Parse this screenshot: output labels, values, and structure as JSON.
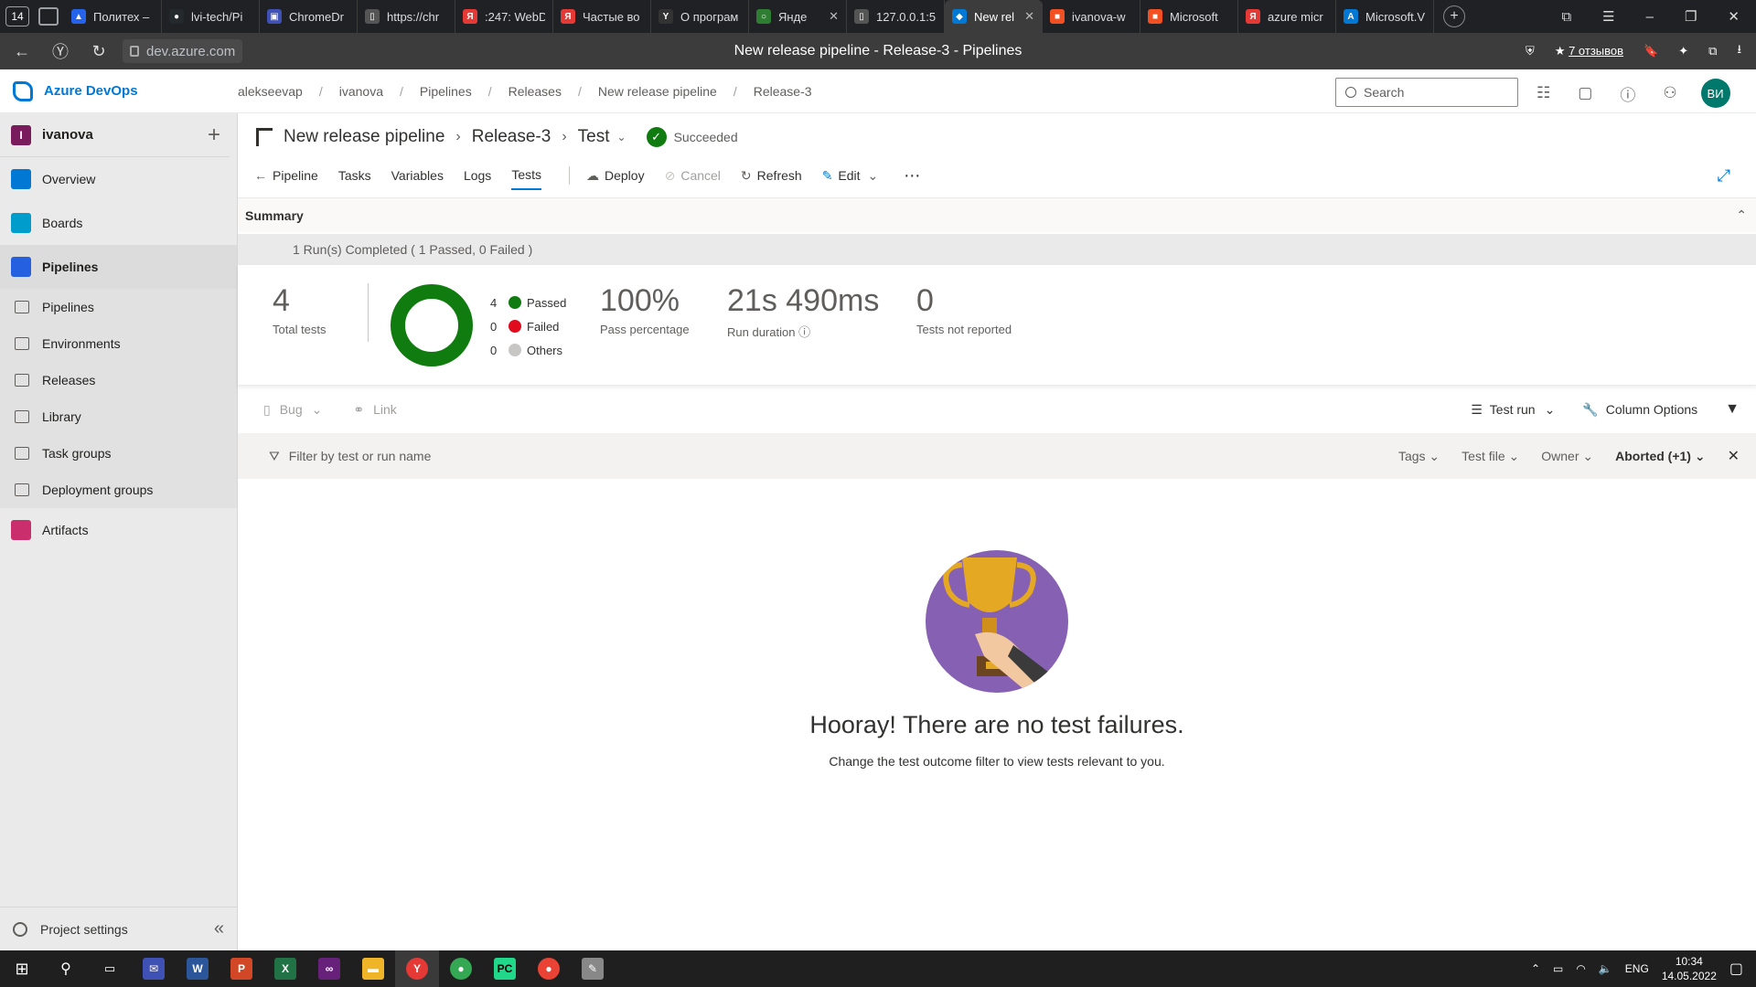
{
  "browser": {
    "tab_count": "14",
    "tabs": [
      {
        "label": "Политех –",
        "color": "#2563eb",
        "glyph": "▲"
      },
      {
        "label": "lvi-tech/Pi",
        "color": "#24292e",
        "glyph": "●"
      },
      {
        "label": "ChromeDr",
        "color": "#3f51b5",
        "glyph": "▣"
      },
      {
        "label": "https://chr",
        "color": "#555555",
        "glyph": "▯"
      },
      {
        "label": ":247: WebD",
        "color": "#e53935",
        "glyph": "Я"
      },
      {
        "label": "Частые во",
        "color": "#e53935",
        "glyph": "Я"
      },
      {
        "label": "О програм",
        "color": "#333333",
        "glyph": "Y"
      },
      {
        "label": "Янде",
        "color": "#2e7d32",
        "glyph": "○"
      },
      {
        "label": "127.0.0.1:5",
        "color": "#555555",
        "glyph": "▯"
      },
      {
        "label": "New rel",
        "color": "#0078d4",
        "glyph": "◆"
      },
      {
        "label": "ivanova-w",
        "color": "#f25022",
        "glyph": "■"
      },
      {
        "label": "Microsoft",
        "color": "#f25022",
        "glyph": "■"
      },
      {
        "label": "azure micr",
        "color": "#e53935",
        "glyph": "Я"
      },
      {
        "label": "Microsoft.V",
        "color": "#0078d4",
        "glyph": "A"
      }
    ],
    "url": "dev.azure.com",
    "page_title": "New release pipeline - Release-3 - Pipelines",
    "reviews": "7 отзывов"
  },
  "header": {
    "app_name": "Azure DevOps",
    "breadcrumbs": [
      "alekseevap",
      "ivanova",
      "Pipelines",
      "Releases",
      "New release pipeline",
      "Release-3"
    ],
    "search_placeholder": "Search",
    "avatar": "ВИ"
  },
  "sidebar": {
    "project": "ivanova",
    "project_initial": "I",
    "items": [
      {
        "label": "Overview",
        "color": "#0078d4"
      },
      {
        "label": "Boards",
        "color": "#009ccc"
      },
      {
        "label": "Pipelines",
        "color": "#2560e0"
      }
    ],
    "sub_items": [
      "Pipelines",
      "Environments",
      "Releases",
      "Library",
      "Task groups",
      "Deployment groups"
    ],
    "artifacts": {
      "label": "Artifacts",
      "color": "#cb2e6d"
    },
    "settings": "Project settings"
  },
  "page": {
    "pipeline": "New release pipeline",
    "release": "Release-3",
    "stage": "Test",
    "status": "Succeeded",
    "tabs": [
      "Pipeline",
      "Tasks",
      "Variables",
      "Logs",
      "Tests"
    ],
    "active_tab": "Tests",
    "actions": {
      "deploy": "Deploy",
      "cancel": "Cancel",
      "refresh": "Refresh",
      "edit": "Edit"
    }
  },
  "summary": {
    "title": "Summary",
    "run_line": "1 Run(s) Completed ( 1 Passed, 0 Failed )",
    "total_tests": "4",
    "total_label": "Total tests",
    "legend": [
      {
        "count": "4",
        "label": "Passed",
        "color": "#107c10"
      },
      {
        "count": "0",
        "label": "Failed",
        "color": "#e00b1c"
      },
      {
        "count": "0",
        "label": "Others",
        "color": "#c8c6c4"
      }
    ],
    "pass_pct": "100%",
    "pass_label": "Pass percentage",
    "duration": "21s 490ms",
    "duration_label": "Run duration",
    "not_reported": "0",
    "not_reported_label": "Tests not reported"
  },
  "results_toolbar": {
    "bug": "Bug",
    "link": "Link",
    "group_by": "Test run",
    "column_options": "Column Options"
  },
  "filter": {
    "placeholder": "Filter by test or run name",
    "tags": "Tags",
    "test_file": "Test file",
    "owner": "Owner",
    "outcome": "Aborted (+1)"
  },
  "empty_state": {
    "headline": "Hooray! There are no test failures.",
    "subline": "Change the test outcome filter to view tests relevant to you."
  },
  "taskbar": {
    "lang": "ENG",
    "time": "10:34",
    "date": "14.05.2022"
  }
}
